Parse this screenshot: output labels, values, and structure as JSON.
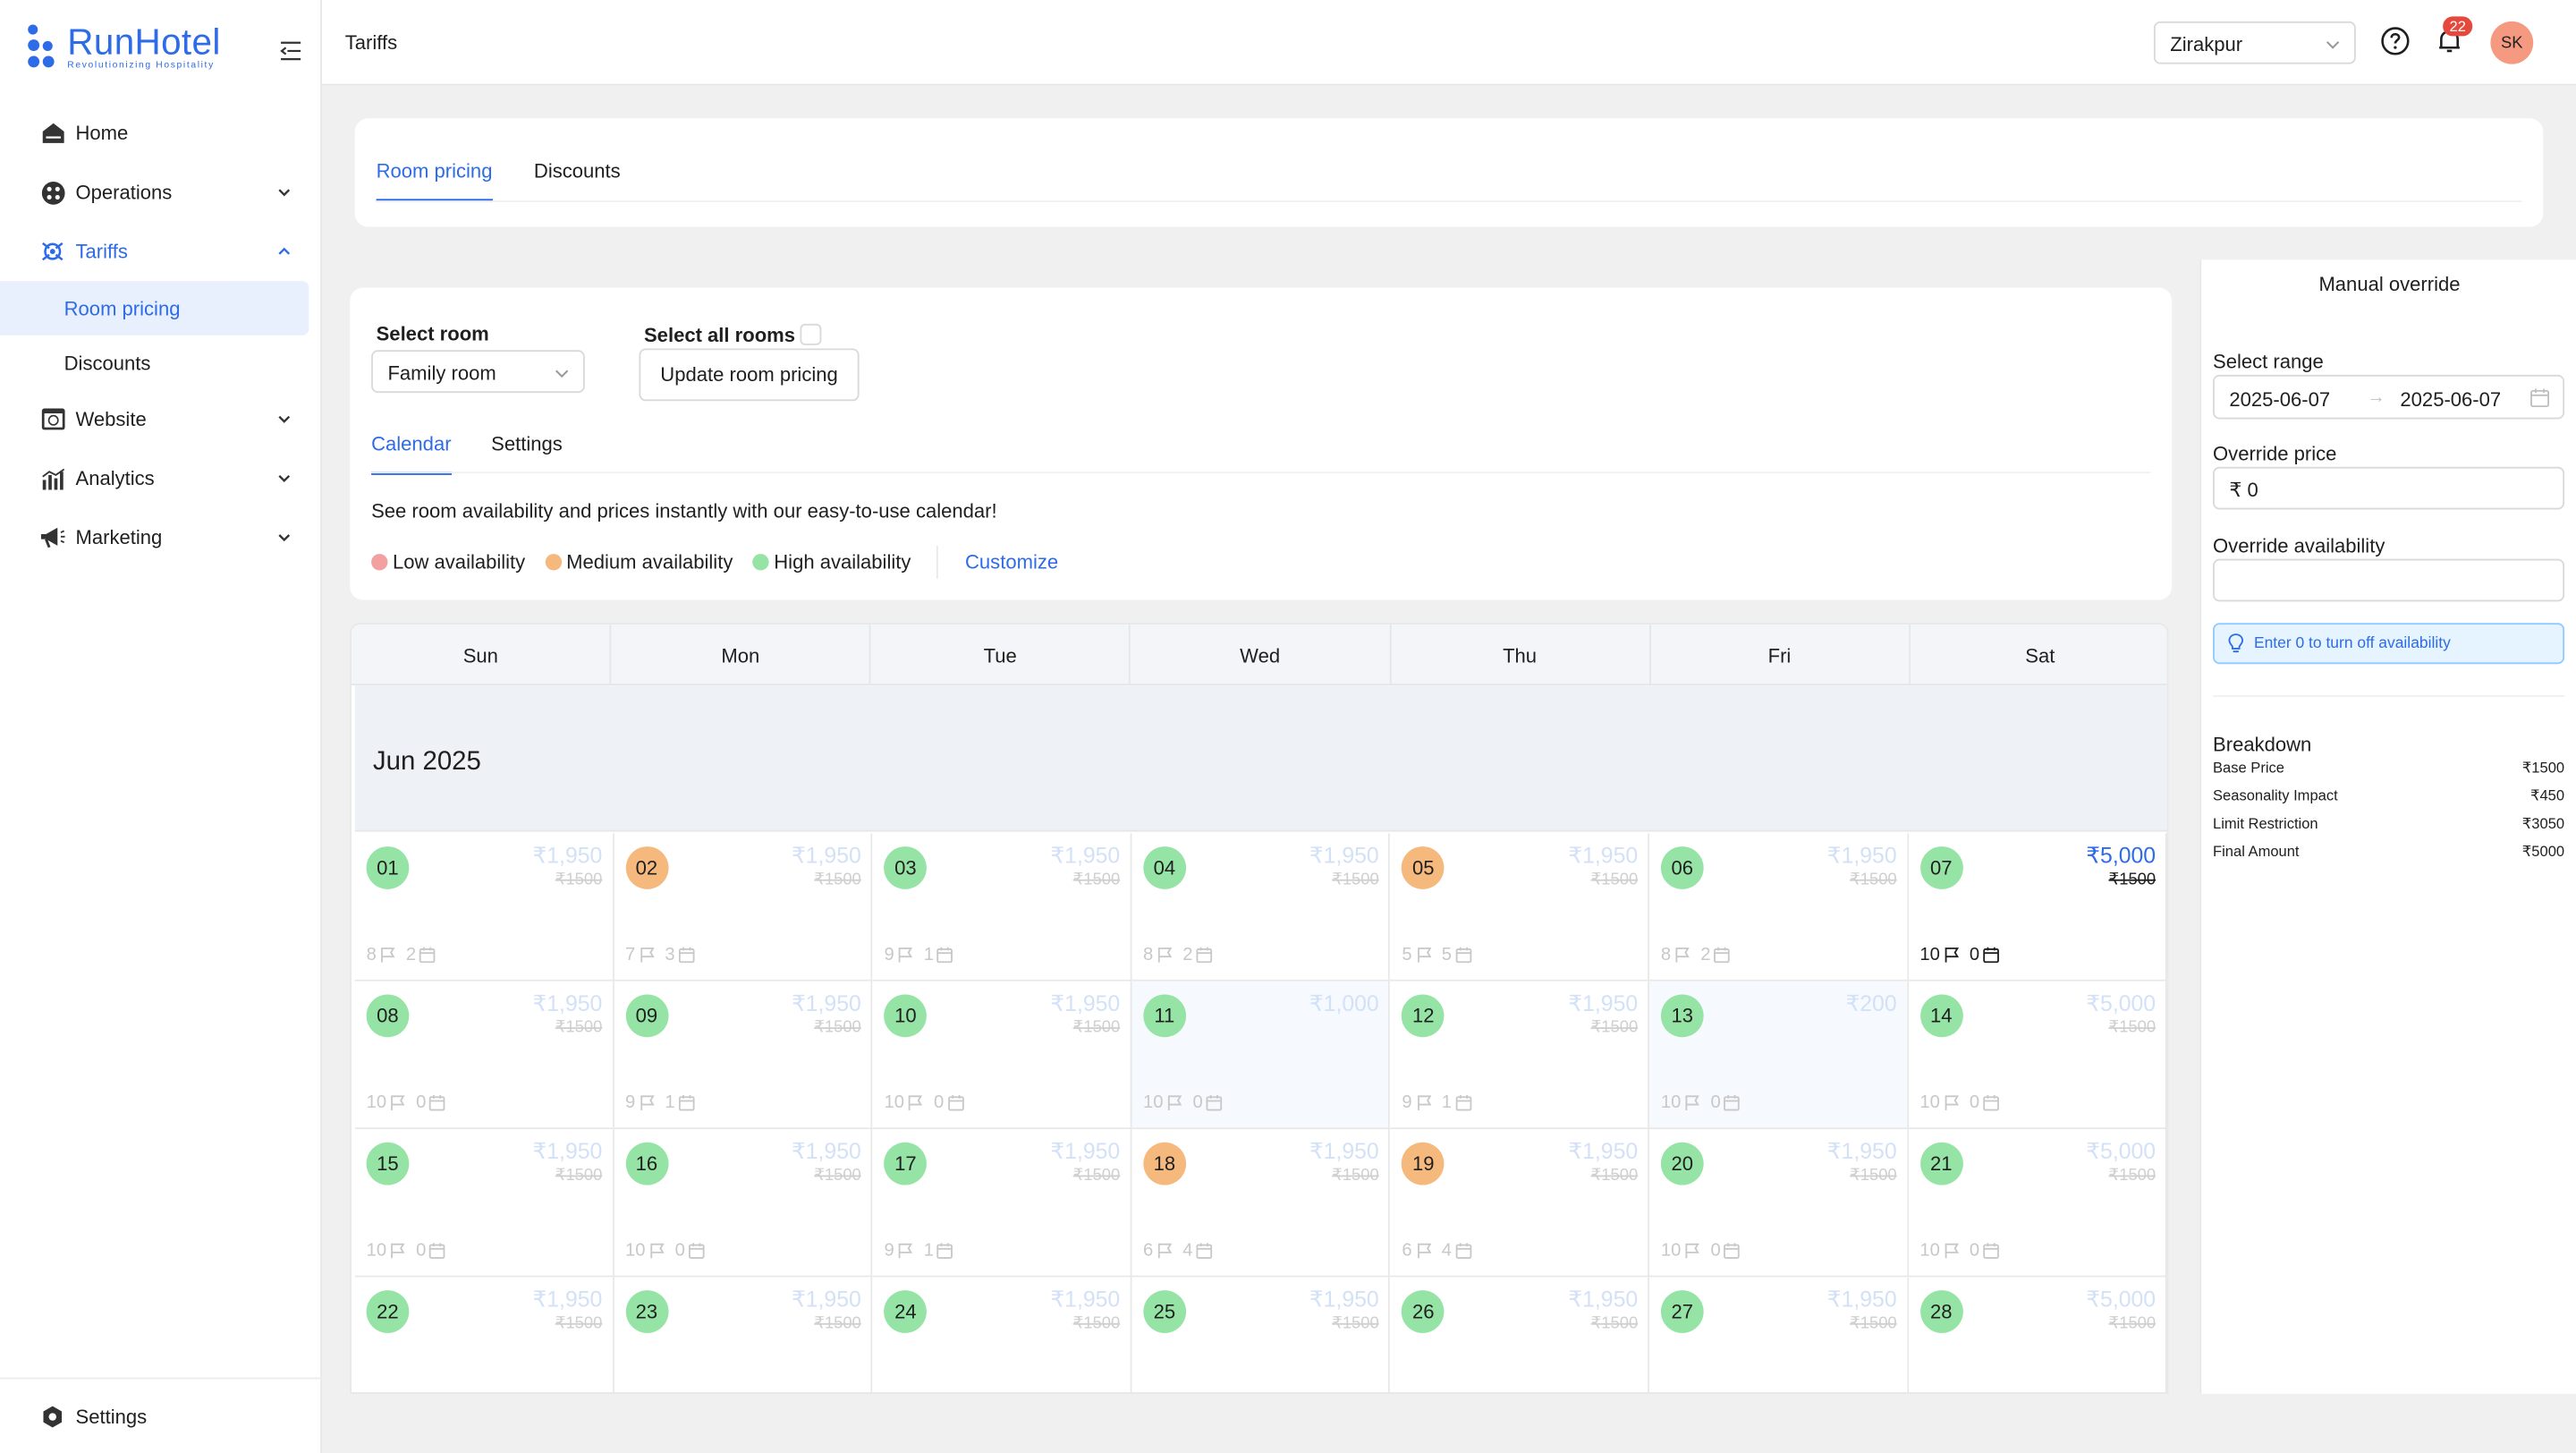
{
  "app": {
    "brand": "RunHotel",
    "tagline": "Revolutionizing Hospitality",
    "colors": {
      "accent": "#2e6be6",
      "high": "#95e4a6",
      "medium": "#f5b97d",
      "low": "#f2a0a0",
      "badge": "#e5483c"
    }
  },
  "sidebar": {
    "items": [
      {
        "label": "Home",
        "icon": "home-icon"
      },
      {
        "label": "Operations",
        "icon": "operations-icon"
      },
      {
        "label": "Tariffs",
        "icon": "tariffs-icon"
      },
      {
        "label": "Room pricing"
      },
      {
        "label": "Discounts"
      },
      {
        "label": "Website",
        "icon": "website-icon"
      },
      {
        "label": "Analytics",
        "icon": "analytics-icon"
      },
      {
        "label": "Marketing",
        "icon": "marketing-icon"
      }
    ],
    "settings_label": "Settings"
  },
  "header": {
    "title": "Tariffs",
    "location": "Zirakpur",
    "notifications": "22",
    "avatar": "SK"
  },
  "tabs": {
    "room_pricing": "Room pricing",
    "discounts": "Discounts"
  },
  "controls": {
    "select_room_label": "Select room",
    "room_value": "Family room",
    "select_all_label": "Select all rooms",
    "update_button": "Update room pricing",
    "calendar_tab": "Calendar",
    "settings_tab": "Settings",
    "description": "See room availability and prices instantly with our easy-to-use calendar!",
    "legend": {
      "low": "Low availability",
      "medium": "Medium availability",
      "high": "High availability",
      "customize": "Customize"
    }
  },
  "calendar": {
    "weekdays": [
      "Sun",
      "Mon",
      "Tue",
      "Wed",
      "Thu",
      "Fri",
      "Sat"
    ],
    "month": "Jun 2025",
    "days": [
      {
        "day": "01",
        "level": "high",
        "price": "₹1,950",
        "base": "₹1500",
        "a": "8",
        "b": "2"
      },
      {
        "day": "02",
        "level": "med",
        "price": "₹1,950",
        "base": "₹1500",
        "a": "7",
        "b": "3"
      },
      {
        "day": "03",
        "level": "high",
        "price": "₹1,950",
        "base": "₹1500",
        "a": "9",
        "b": "1"
      },
      {
        "day": "04",
        "level": "high",
        "price": "₹1,950",
        "base": "₹1500",
        "a": "8",
        "b": "2"
      },
      {
        "day": "05",
        "level": "med",
        "price": "₹1,950",
        "base": "₹1500",
        "a": "5",
        "b": "5"
      },
      {
        "day": "06",
        "level": "high",
        "price": "₹1,950",
        "base": "₹1500",
        "a": "8",
        "b": "2"
      },
      {
        "day": "07",
        "level": "high",
        "price": "₹5,000",
        "base": "₹1500",
        "a": "10",
        "b": "0",
        "selected": true
      },
      {
        "day": "08",
        "level": "high",
        "price": "₹1,950",
        "base": "₹1500",
        "a": "10",
        "b": "0"
      },
      {
        "day": "09",
        "level": "high",
        "price": "₹1,950",
        "base": "₹1500",
        "a": "9",
        "b": "1"
      },
      {
        "day": "10",
        "level": "high",
        "price": "₹1,950",
        "base": "₹1500",
        "a": "10",
        "b": "0"
      },
      {
        "day": "11",
        "level": "high",
        "price": "₹1,000",
        "base": "",
        "a": "10",
        "b": "0",
        "tint": true
      },
      {
        "day": "12",
        "level": "high",
        "price": "₹1,950",
        "base": "₹1500",
        "a": "9",
        "b": "1"
      },
      {
        "day": "13",
        "level": "high",
        "price": "₹200",
        "base": "",
        "a": "10",
        "b": "0",
        "tint": true
      },
      {
        "day": "14",
        "level": "high",
        "price": "₹5,000",
        "base": "₹1500",
        "a": "10",
        "b": "0"
      },
      {
        "day": "15",
        "level": "high",
        "price": "₹1,950",
        "base": "₹1500",
        "a": "10",
        "b": "0"
      },
      {
        "day": "16",
        "level": "high",
        "price": "₹1,950",
        "base": "₹1500",
        "a": "10",
        "b": "0"
      },
      {
        "day": "17",
        "level": "high",
        "price": "₹1,950",
        "base": "₹1500",
        "a": "9",
        "b": "1"
      },
      {
        "day": "18",
        "level": "med",
        "price": "₹1,950",
        "base": "₹1500",
        "a": "6",
        "b": "4"
      },
      {
        "day": "19",
        "level": "med",
        "price": "₹1,950",
        "base": "₹1500",
        "a": "6",
        "b": "4"
      },
      {
        "day": "20",
        "level": "high",
        "price": "₹1,950",
        "base": "₹1500",
        "a": "10",
        "b": "0"
      },
      {
        "day": "21",
        "level": "high",
        "price": "₹5,000",
        "base": "₹1500",
        "a": "10",
        "b": "0"
      },
      {
        "day": "22",
        "level": "high",
        "price": "₹1,950",
        "base": "₹1500",
        "a": "",
        "b": ""
      },
      {
        "day": "23",
        "level": "high",
        "price": "₹1,950",
        "base": "₹1500",
        "a": "",
        "b": ""
      },
      {
        "day": "24",
        "level": "high",
        "price": "₹1,950",
        "base": "₹1500",
        "a": "",
        "b": ""
      },
      {
        "day": "25",
        "level": "high",
        "price": "₹1,950",
        "base": "₹1500",
        "a": "",
        "b": ""
      },
      {
        "day": "26",
        "level": "high",
        "price": "₹1,950",
        "base": "₹1500",
        "a": "",
        "b": ""
      },
      {
        "day": "27",
        "level": "high",
        "price": "₹1,950",
        "base": "₹1500",
        "a": "",
        "b": ""
      },
      {
        "day": "28",
        "level": "high",
        "price": "₹5,000",
        "base": "₹1500",
        "a": "",
        "b": ""
      }
    ]
  },
  "override": {
    "title": "Manual override",
    "range_label": "Select range",
    "start_date": "2025-06-07",
    "end_date": "2025-06-07",
    "price_label": "Override price",
    "price_value": "₹ 0",
    "availability_label": "Override availability",
    "availability_value": "",
    "hint": "Enter 0 to turn off availability",
    "breakdown_title": "Breakdown",
    "breakdown": [
      {
        "label": "Base Price",
        "value": "₹1500"
      },
      {
        "label": "Seasonality Impact",
        "value": "₹450"
      },
      {
        "label": "Limit Restriction",
        "value": "₹3050"
      },
      {
        "label": "Final Amount",
        "value": "₹5000"
      }
    ]
  }
}
